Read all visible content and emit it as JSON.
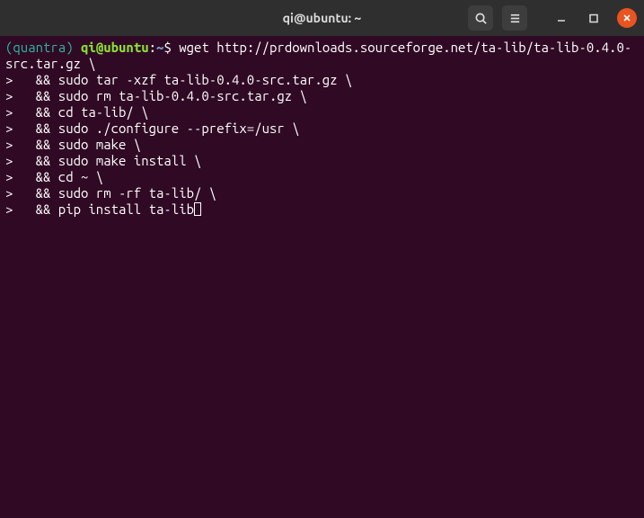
{
  "titlebar": {
    "title": "qi@ubuntu: ~"
  },
  "prompt": {
    "env": "(quantra)",
    "user_host": "qi@ubuntu",
    "sep": ":",
    "path": "~",
    "symbol": "$"
  },
  "cmd": {
    "first": "wget http://prdownloads.sourceforge.net/ta-lib/ta-lib-0.4.0-src.tar.gz \\",
    "lines": [
      ">   && sudo tar -xzf ta-lib-0.4.0-src.tar.gz \\",
      ">   && sudo rm ta-lib-0.4.0-src.tar.gz \\",
      ">   && cd ta-lib/ \\",
      ">   && sudo ./configure --prefix=/usr \\",
      ">   && sudo make \\",
      ">   && sudo make install \\",
      ">   && cd ~ \\",
      ">   && sudo rm -rf ta-lib/ \\",
      ">   && pip install ta-lib"
    ]
  }
}
